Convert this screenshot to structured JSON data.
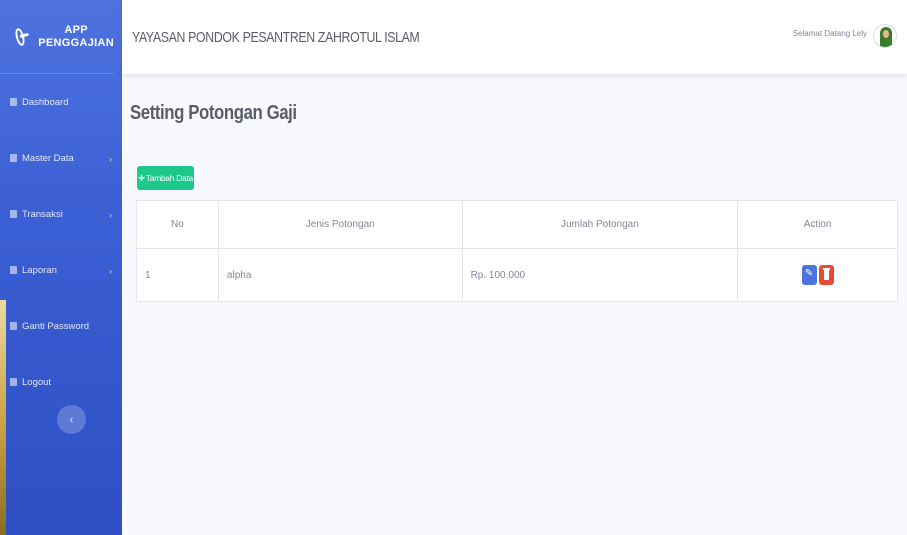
{
  "brand": {
    "line1": "APP",
    "line2": "PENGGAJIAN"
  },
  "sidebar": {
    "items": [
      {
        "label": "Dashboard",
        "icon": "dashboard-icon",
        "has_submenu": false
      },
      {
        "label": "Master Data",
        "icon": "folder-icon",
        "has_submenu": true
      },
      {
        "label": "Transaksi",
        "icon": "table-icon",
        "has_submenu": true
      },
      {
        "label": "Laporan",
        "icon": "file-icon",
        "has_submenu": true
      },
      {
        "label": "Ganti Password",
        "icon": "lock-icon",
        "has_submenu": false
      },
      {
        "label": "Logout",
        "icon": "logout-icon",
        "has_submenu": false
      }
    ],
    "toggle_icon": "‹"
  },
  "topbar": {
    "org_name": "YAYASAN PONDOK PESANTREN ZAHROTUL ISLAM",
    "welcome": "Selamat Datang Lely"
  },
  "page": {
    "title": "Setting Potongan Gaji",
    "add_button": "Tambah Data",
    "add_icon": "+"
  },
  "table": {
    "headers": {
      "no": "No",
      "jenis": "Jenis Potongan",
      "jumlah": "Jumlah Potongan",
      "action": "Action"
    },
    "rows": [
      {
        "no": "1",
        "jenis": "alpha",
        "jumlah": "Rp. 100.000"
      }
    ]
  },
  "colors": {
    "sidebar": "#4e73df",
    "success": "#1cc88a",
    "primary": "#4e73df",
    "danger": "#e74a3b"
  }
}
